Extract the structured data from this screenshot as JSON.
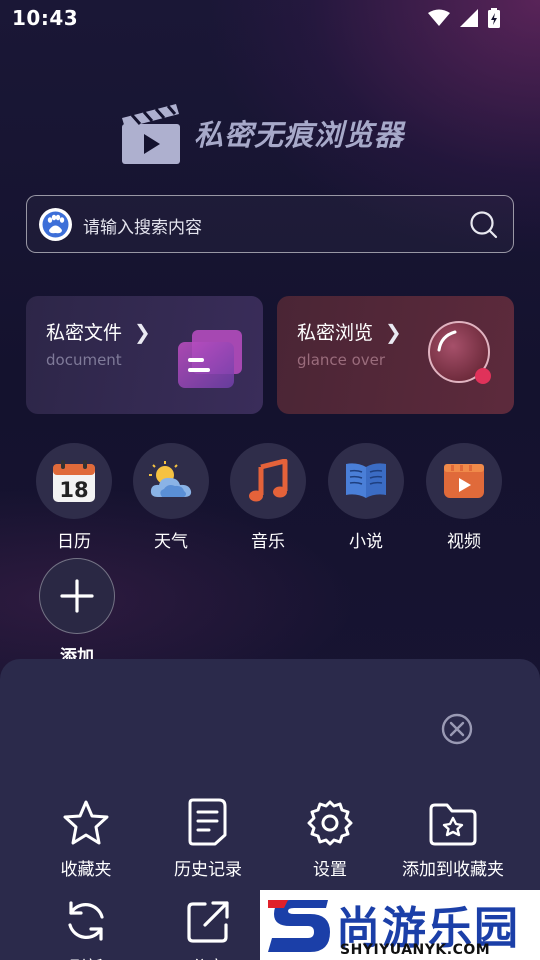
{
  "status_bar": {
    "time": "10:43"
  },
  "header": {
    "app_title": "私密无痕浏览器"
  },
  "search": {
    "placeholder": "请输入搜索内容"
  },
  "cards": [
    {
      "title": "私密文件",
      "subtitle": "document"
    },
    {
      "title": "私密浏览",
      "subtitle": "glance over"
    }
  ],
  "shortcuts": [
    {
      "label": "日历",
      "icon": "calendar-icon",
      "date_number": "18"
    },
    {
      "label": "天气",
      "icon": "weather-icon"
    },
    {
      "label": "音乐",
      "icon": "music-icon"
    },
    {
      "label": "小说",
      "icon": "book-icon"
    },
    {
      "label": "视频",
      "icon": "video-icon"
    }
  ],
  "add_shortcut": {
    "label": "添加",
    "icon": "plus-icon"
  },
  "menu": {
    "items": [
      {
        "label": "收藏夹",
        "icon": "star-icon"
      },
      {
        "label": "历史记录",
        "icon": "history-icon"
      },
      {
        "label": "设置",
        "icon": "gear-icon"
      },
      {
        "label": "添加到收藏夹",
        "icon": "folder-star-icon"
      },
      {
        "label": "刷新",
        "icon": "refresh-icon"
      },
      {
        "label": "分享",
        "icon": "share-icon"
      }
    ]
  },
  "watermark": {
    "brand": "尚游乐园",
    "url": "SHYIYUANYK.COM"
  },
  "colors": {
    "background": "#14122e",
    "sheet": "#2b2a4b",
    "accent_orange": "#e06a3a"
  }
}
